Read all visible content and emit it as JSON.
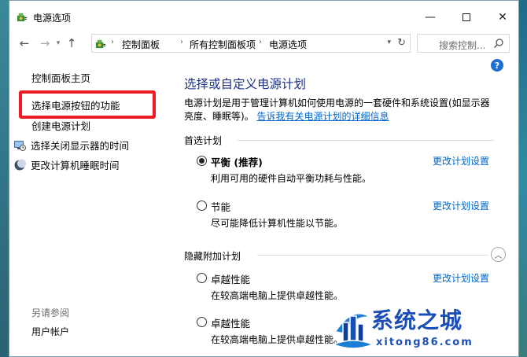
{
  "window": {
    "title": "电源选项"
  },
  "nav": {
    "breadcrumbs": [
      "控制面板",
      "所有控制面板项",
      "电源选项"
    ],
    "search_placeholder": "搜索控制..."
  },
  "sidebar": {
    "home": "控制面板主页",
    "items": [
      {
        "label": "选择电源按钮的功能",
        "icon": null
      },
      {
        "label": "创建电源计划",
        "icon": null
      },
      {
        "label": "选择关闭显示器的时间",
        "icon": "monitor-clock-icon"
      },
      {
        "label": "更改计算机睡眠时间",
        "icon": "moon-icon"
      }
    ],
    "see_also": "另请参阅",
    "user_accounts": "用户帐户"
  },
  "main": {
    "title": "选择或自定义电源计划",
    "description": "电源计划是用于管理计算机如何使用电源的一套硬件和系统设置(如显示器亮度、睡眠等)。",
    "description_link": "告诉我有关电源计划的详细信息",
    "preferred_label": "首选计划",
    "hidden_label": "隐藏附加计划",
    "change_label": "更改计划设置",
    "plans": [
      {
        "name": "平衡 (推荐)",
        "desc": "利用可用的硬件自动平衡功耗与性能。",
        "checked": true
      },
      {
        "name": "节能",
        "desc": "尽可能降低计算机性能以节能。",
        "checked": false
      },
      {
        "name": "卓越性能",
        "desc": "在较高端电脑上提供卓越性能。",
        "checked": false
      },
      {
        "name": "卓越性能",
        "desc": "在较高端电脑上提供卓越性能。",
        "checked": false
      }
    ]
  },
  "watermark": {
    "title": "系统之城",
    "url": "xitong86.com"
  },
  "colors": {
    "title_blue": "#1e3287",
    "link_blue": "#0066cc",
    "highlight_red": "#ee1c24"
  }
}
